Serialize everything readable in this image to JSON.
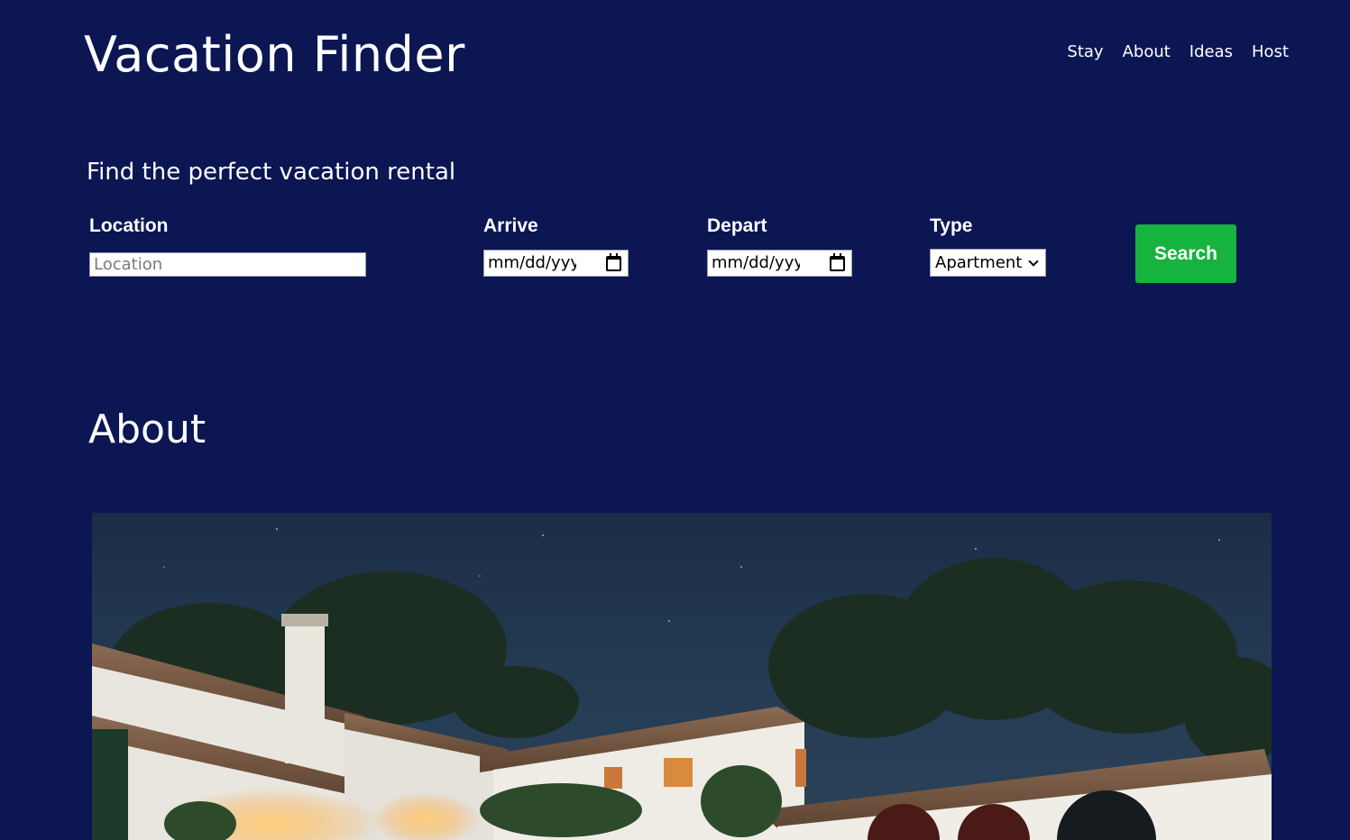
{
  "header": {
    "site_title": "Vacation Finder",
    "nav": [
      "Stay",
      "About",
      "Ideas",
      "Host"
    ]
  },
  "search": {
    "tagline": "Find the perfect vacation rental",
    "location_label": "Location",
    "location_placeholder": "Location",
    "arrive_label": "Arrive",
    "arrive_value": "mm/dd/yyyy",
    "depart_label": "Depart",
    "depart_value": "mm/dd/yyyy",
    "type_label": "Type",
    "type_selected": "Apartment",
    "search_button": "Search"
  },
  "about": {
    "heading": "About",
    "image_subject": "villa-at-night-photo"
  },
  "colors": {
    "background": "#0b1653",
    "text": "#ffffff",
    "search_button": "#16b43e"
  },
  "icons": [
    "calendar-icon",
    "chevron-down-icon"
  ]
}
